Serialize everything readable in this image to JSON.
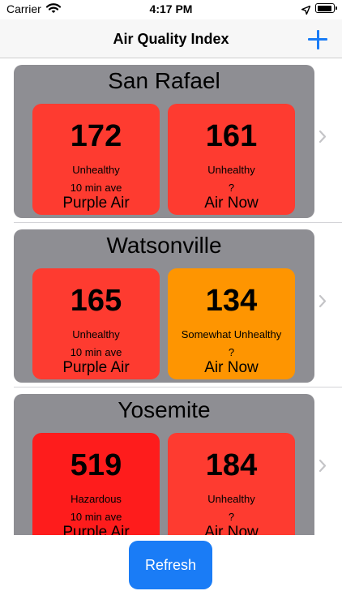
{
  "status_bar": {
    "carrier": "Carrier",
    "time": "4:17 PM"
  },
  "nav": {
    "title": "Air Quality Index",
    "add_icon": "plus-icon"
  },
  "colors": {
    "unhealthy": "#fe3b30",
    "somewhat_unhealthy": "#fe9501",
    "hazardous": "#fe1c1c",
    "card": "#8e8e93",
    "accent": "#1a7cf6"
  },
  "locations": [
    {
      "city": "San Rafael",
      "purple_air": {
        "aqi": "172",
        "category": "Unhealthy",
        "detail": "10 min ave",
        "source": "Purple Air",
        "color": "#fe3b30"
      },
      "air_now": {
        "aqi": "161",
        "category": "Unhealthy",
        "detail": "?",
        "source": "Air Now",
        "color": "#fe3b30"
      }
    },
    {
      "city": "Watsonville",
      "purple_air": {
        "aqi": "165",
        "category": "Unhealthy",
        "detail": "10 min ave",
        "source": "Purple Air",
        "color": "#fe3b30"
      },
      "air_now": {
        "aqi": "134",
        "category": "Somewhat Unhealthy",
        "detail": "?",
        "source": "Air Now",
        "color": "#fe9501"
      }
    },
    {
      "city": "Yosemite",
      "purple_air": {
        "aqi": "519",
        "category": "Hazardous",
        "detail": "10 min ave",
        "source": "Purple Air",
        "color": "#fe1c1c"
      },
      "air_now": {
        "aqi": "184",
        "category": "Unhealthy",
        "detail": "?",
        "source": "Air Now",
        "color": "#fe3b30"
      }
    }
  ],
  "refresh_button": {
    "label": "Refresh"
  }
}
